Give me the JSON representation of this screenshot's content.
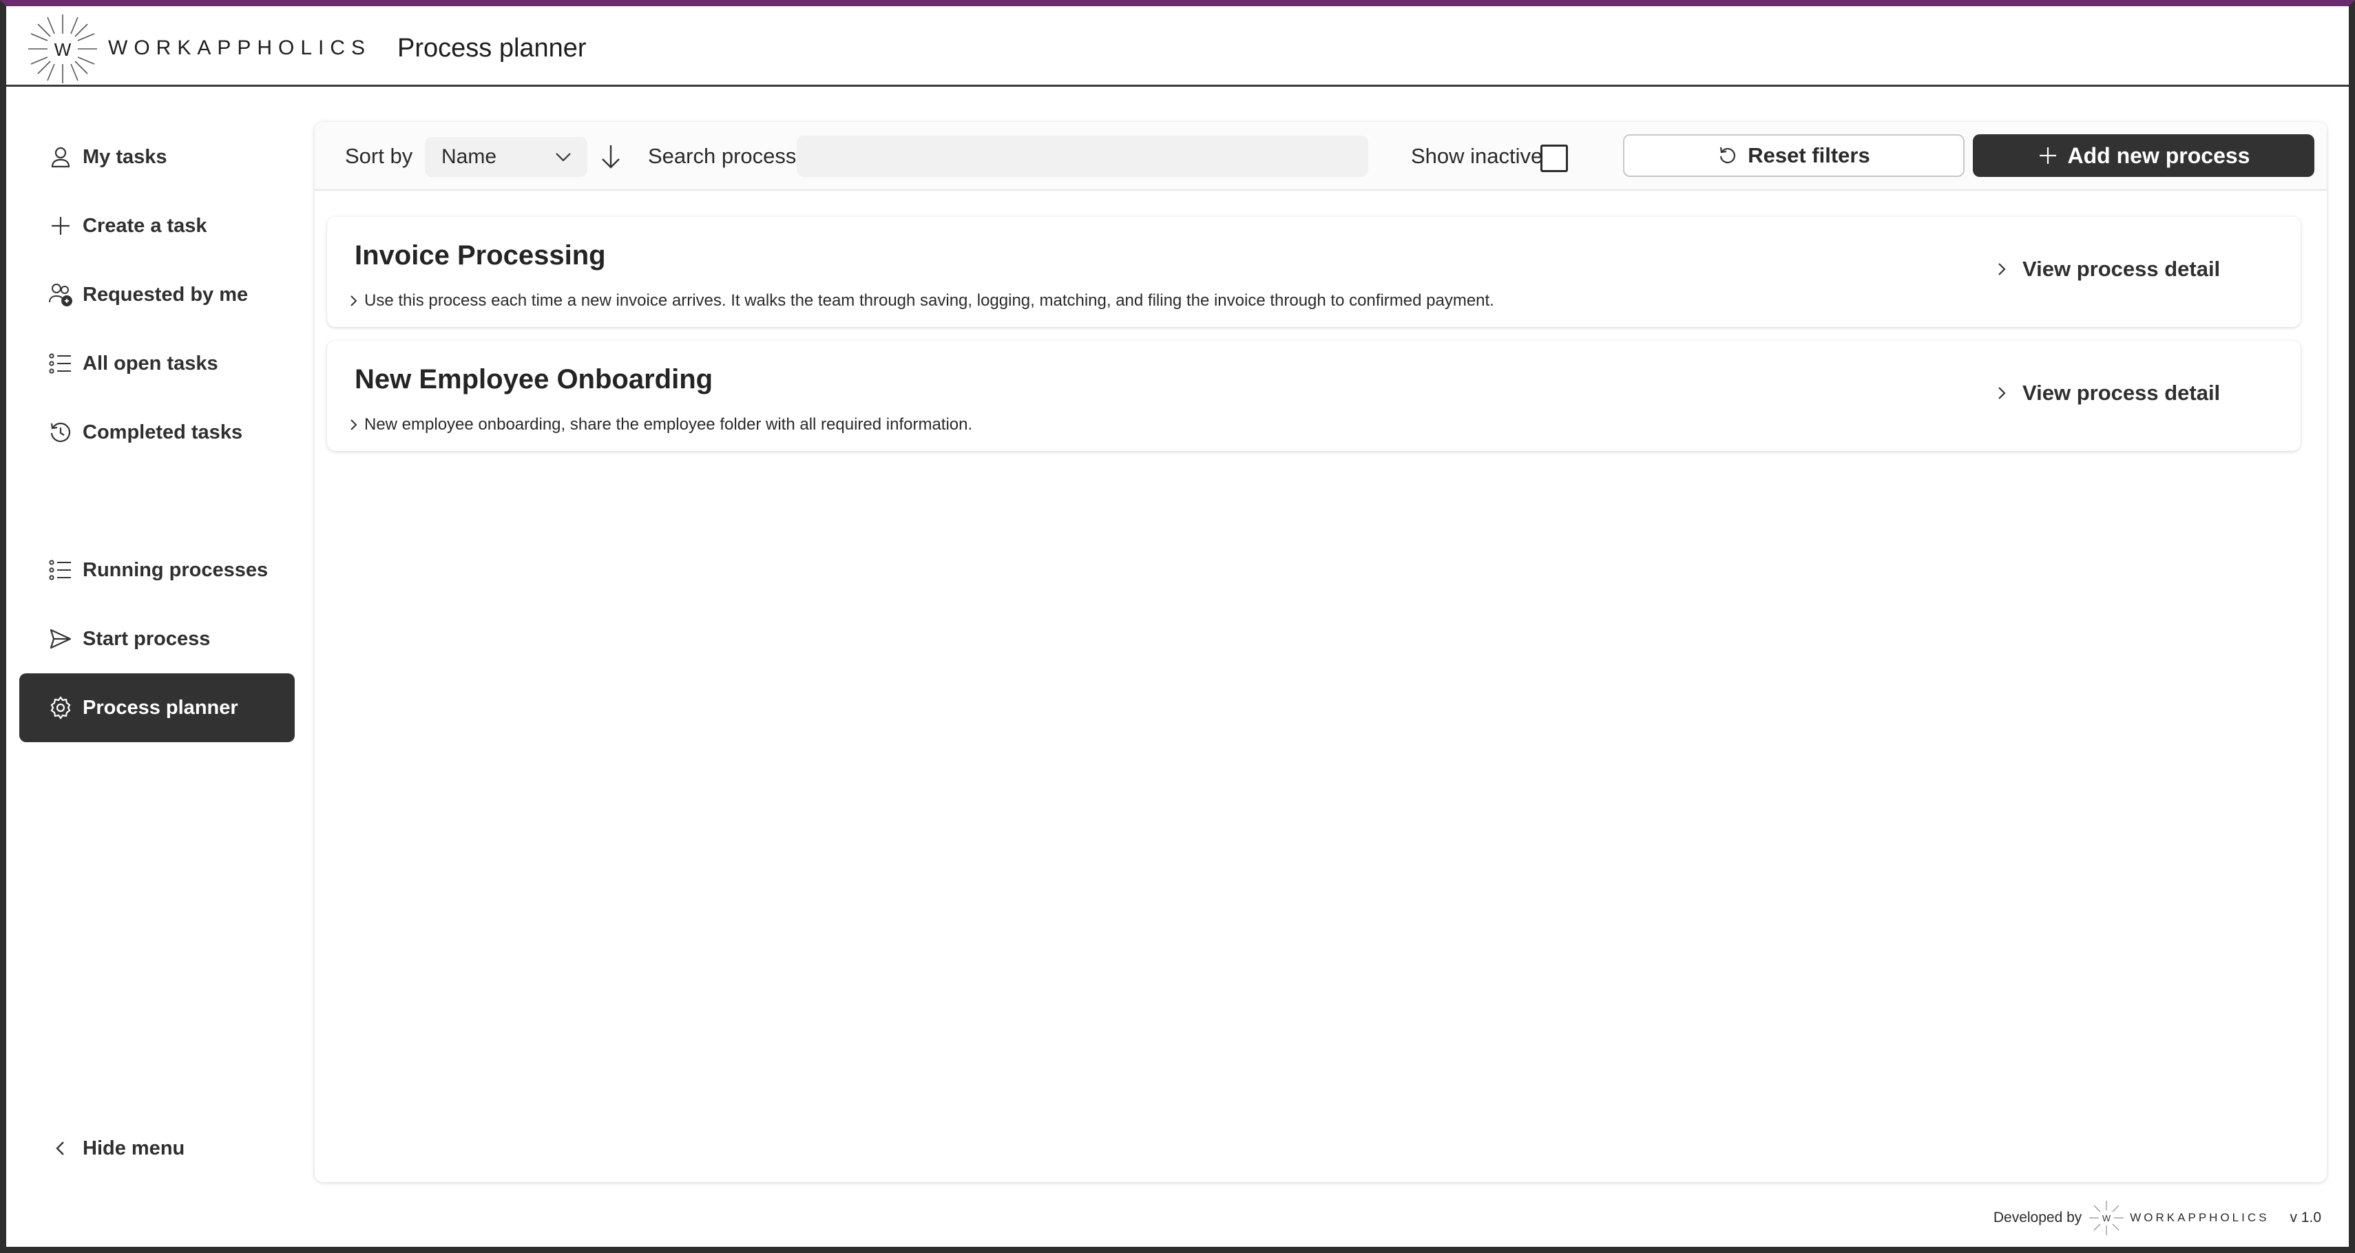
{
  "header": {
    "brand": "WORKAPPHOLICS",
    "logo_letter": "W",
    "title": "Process planner"
  },
  "sidebar": {
    "items": [
      {
        "label": "My tasks",
        "icon": "person-icon"
      },
      {
        "label": "Create a task",
        "icon": "plus-icon"
      },
      {
        "label": "Requested by me",
        "icon": "people-icon"
      },
      {
        "label": "All open tasks",
        "icon": "list-icon"
      },
      {
        "label": "Completed tasks",
        "icon": "history-icon"
      },
      {
        "label": "Running processes",
        "icon": "list-icon"
      },
      {
        "label": "Start process",
        "icon": "send-icon"
      },
      {
        "label": "Process planner",
        "icon": "gear-icon",
        "active": true
      }
    ],
    "hide_menu": "Hide menu"
  },
  "toolbar": {
    "sort_label": "Sort by",
    "sort_value": "Name",
    "search_label": "Search process",
    "search_value": "",
    "show_inactive_label": "Show inactive",
    "reset_label": "Reset filters",
    "add_label": "Add new process"
  },
  "processes": [
    {
      "title": "Invoice Processing",
      "description": "Use this process each time a new invoice arrives. It walks the team through saving, logging, matching, and filing the invoice through to confirmed payment.",
      "link": "View process detail"
    },
    {
      "title": "New Employee Onboarding",
      "description": "New employee onboarding, share the employee folder with all required information.",
      "link": "View process detail"
    }
  ],
  "footer": {
    "developed_by": "Developed by",
    "brand": "WORKAPPHOLICS",
    "version": "v 1.0"
  },
  "colors": {
    "accent_top": "#6b2a6e",
    "active_nav": "#323232",
    "primary_button": "#323232"
  }
}
